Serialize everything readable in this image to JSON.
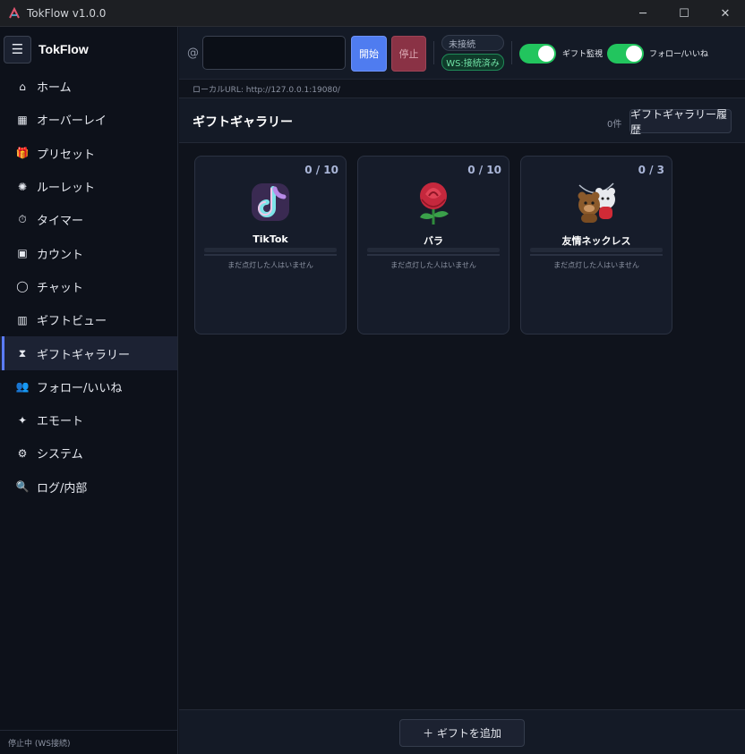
{
  "window": {
    "title": "TokFlow v1.0.0",
    "minimize_glyph": "─",
    "maximize_glyph": "☐",
    "close_glyph": "✕"
  },
  "sidebar": {
    "menu_glyph": "☰",
    "brand": "TokFlow",
    "items": [
      {
        "label": "ホーム",
        "icon": "home-icon",
        "glyph": "⌂",
        "active": false
      },
      {
        "label": "オーバーレイ",
        "icon": "overlay-icon",
        "glyph": "▦",
        "active": false
      },
      {
        "label": "プリセット",
        "icon": "gift-box-icon",
        "glyph": "🎁",
        "active": false
      },
      {
        "label": "ルーレット",
        "icon": "roulette-icon",
        "glyph": "✺",
        "active": false
      },
      {
        "label": "タイマー",
        "icon": "stopwatch-icon",
        "glyph": "⏱",
        "active": false
      },
      {
        "label": "カウント",
        "icon": "counter-icon",
        "glyph": "▣",
        "active": false
      },
      {
        "label": "チャット",
        "icon": "chat-bubble-icon",
        "glyph": "◯",
        "active": false
      },
      {
        "label": "ギフトビュー",
        "icon": "bar-chart-icon",
        "glyph": "▥",
        "active": false
      },
      {
        "label": "ギフトギャラリー",
        "icon": "hourglass-icon",
        "glyph": "⧗",
        "active": true
      },
      {
        "label": "フォロー/いいね",
        "icon": "users-icon",
        "glyph": "👥",
        "active": false
      },
      {
        "label": "エモート",
        "icon": "sparkle-icon",
        "glyph": "✦",
        "active": false
      },
      {
        "label": "システム",
        "icon": "gear-icon",
        "glyph": "⚙",
        "active": false
      },
      {
        "label": "ログ/内部",
        "icon": "magnifier-icon",
        "glyph": "🔍",
        "active": false
      }
    ],
    "status": "停止中 (WS接続)"
  },
  "toolbar": {
    "at_symbol": "@",
    "username_value": "",
    "username_placeholder": "",
    "start_label": "開始",
    "stop_label": "停止",
    "status_disconnected": "未接続",
    "status_ws": "WS:接続済み",
    "gift_monitor_label": "ギフト監視",
    "gift_monitor_on": true,
    "follow_like_label": "フォロー/いいね",
    "follow_like_on": true
  },
  "url_bar": {
    "text": "ローカルURL: http://127.0.0.1:19080/"
  },
  "section": {
    "title": "ギフトギャラリー",
    "count": "0件",
    "history_button": "ギフトギャラリー履歴"
  },
  "gallery": {
    "cards": [
      {
        "name": "TikTok",
        "ratio": "0 / 10",
        "progress": 0,
        "empty_message": "まだ点灯した人はいません",
        "icon": "tiktok-icon"
      },
      {
        "name": "バラ",
        "ratio": "0 / 10",
        "progress": 0,
        "empty_message": "まだ点灯した人はいません",
        "icon": "rose-icon"
      },
      {
        "name": "友情ネックレス",
        "ratio": "0 / 3",
        "progress": 0,
        "empty_message": "まだ点灯した人はいません",
        "icon": "bears-necklace-icon"
      }
    ]
  },
  "footer": {
    "add_button": "＋ ギフトを追加"
  },
  "colors": {
    "accent": "#4f7cf0",
    "stop": "#8a3245",
    "toggle_on": "#22c55e",
    "ws_connected": "#6fe0a4"
  }
}
